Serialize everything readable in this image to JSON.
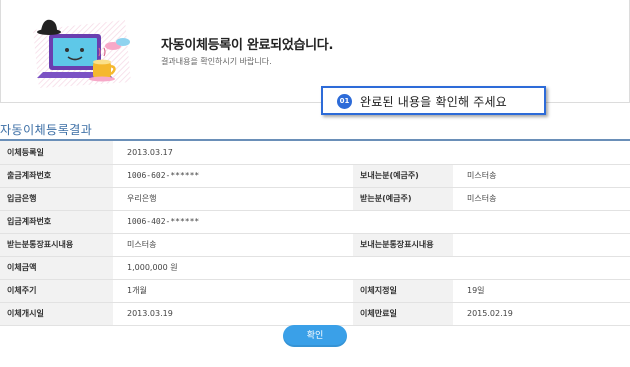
{
  "banner": {
    "title": "자동이체등록이 완료되었습니다.",
    "subtitle": "결과내용을 확인하시기 바랍니다."
  },
  "tooltip": {
    "number": "01",
    "text": "완료된 내용을 확인해 주세요"
  },
  "section_title": "자동이체등록결과",
  "rows": [
    {
      "l1": "이체등록일",
      "v1": "2013.03.17",
      "l2": "",
      "v2": ""
    },
    {
      "l1": "출금계좌번호",
      "v1": "1006-602-******",
      "l2": "보내는분(예금주)",
      "v2": "미스터송"
    },
    {
      "l1": "입금은행",
      "v1": "우리은행",
      "l2": "받는분(예금주)",
      "v2": "미스터송"
    },
    {
      "l1": "입금계좌번호",
      "v1": "1006-402-******",
      "l2": "",
      "v2": ""
    },
    {
      "l1": "받는분통장표시내용",
      "v1": "미스터송",
      "l2": "보내는분통장표시내용",
      "v2": ""
    },
    {
      "l1": "이체금액",
      "v1": "1,000,000 원",
      "l2": "",
      "v2": ""
    },
    {
      "l1": "이체주기",
      "v1": "1개월",
      "l2": "이체지정일",
      "v2": "19일"
    },
    {
      "l1": "이체개시일",
      "v1": "2013.03.19",
      "l2": "이체만료일",
      "v2": "2015.02.19"
    }
  ],
  "confirm_label": "확인",
  "colors": {
    "accent_blue": "#2d6bd8",
    "button_blue": "#3aa0e8",
    "section_title": "#3b6ea5",
    "label_bg": "#f2f2f2"
  },
  "icons": {
    "illustration": "laptop-with-hat-and-coffee-illustration"
  }
}
